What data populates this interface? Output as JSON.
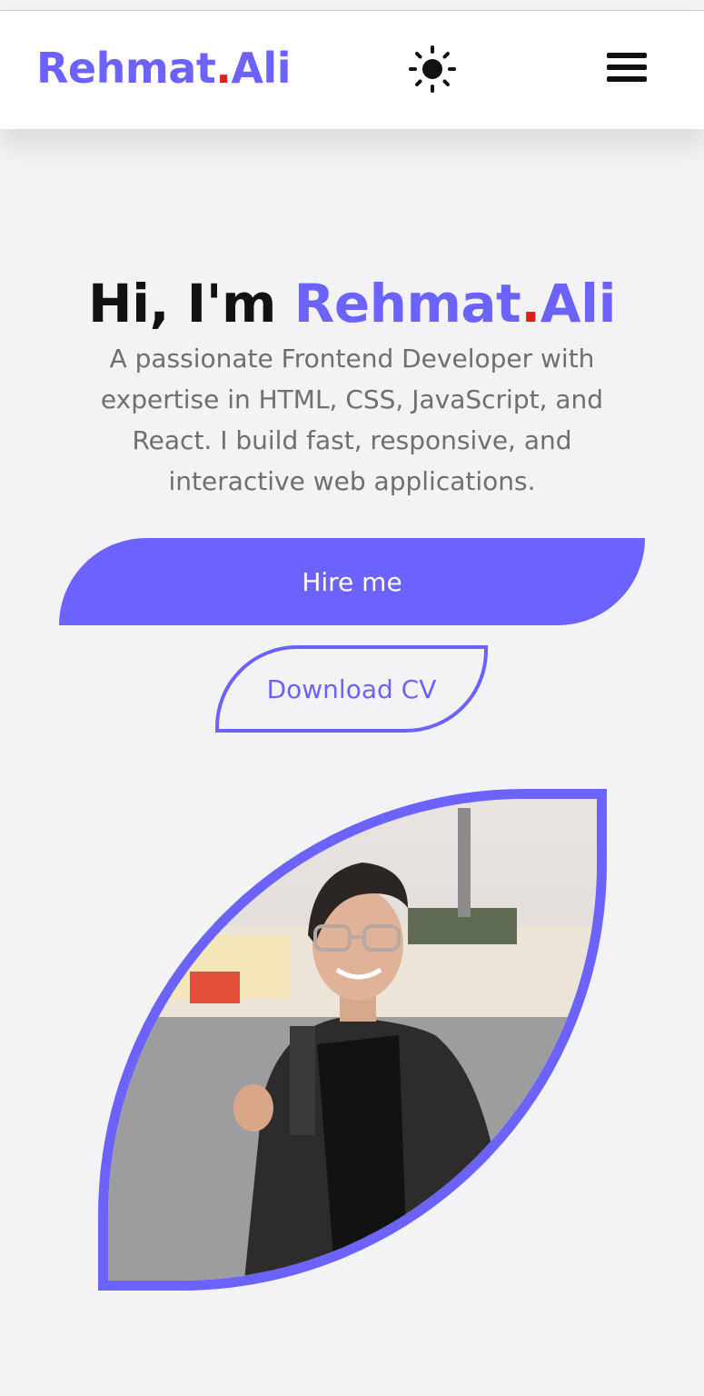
{
  "navbar": {
    "logo_first": "Rehmat",
    "logo_dot": ".",
    "logo_last": "Ali",
    "theme_icon": "sun-icon",
    "menu_icon": "hamburger-menu-icon"
  },
  "hero": {
    "greeting": "Hi, I'm",
    "name_first": "Rehmat",
    "name_dot": ".",
    "name_last": "Ali",
    "description": "A passionate Frontend Developer with expertise in HTML, CSS, JavaScript, and React. I build fast, responsive, and interactive web applications.",
    "hire_label": "Hire me",
    "cv_label": "Download CV"
  },
  "colors": {
    "accent": "#6c63ff",
    "dot": "#e11d1d",
    "heading": "#111111",
    "body_text": "#6f6f6f",
    "background": "#f3f3f6"
  }
}
